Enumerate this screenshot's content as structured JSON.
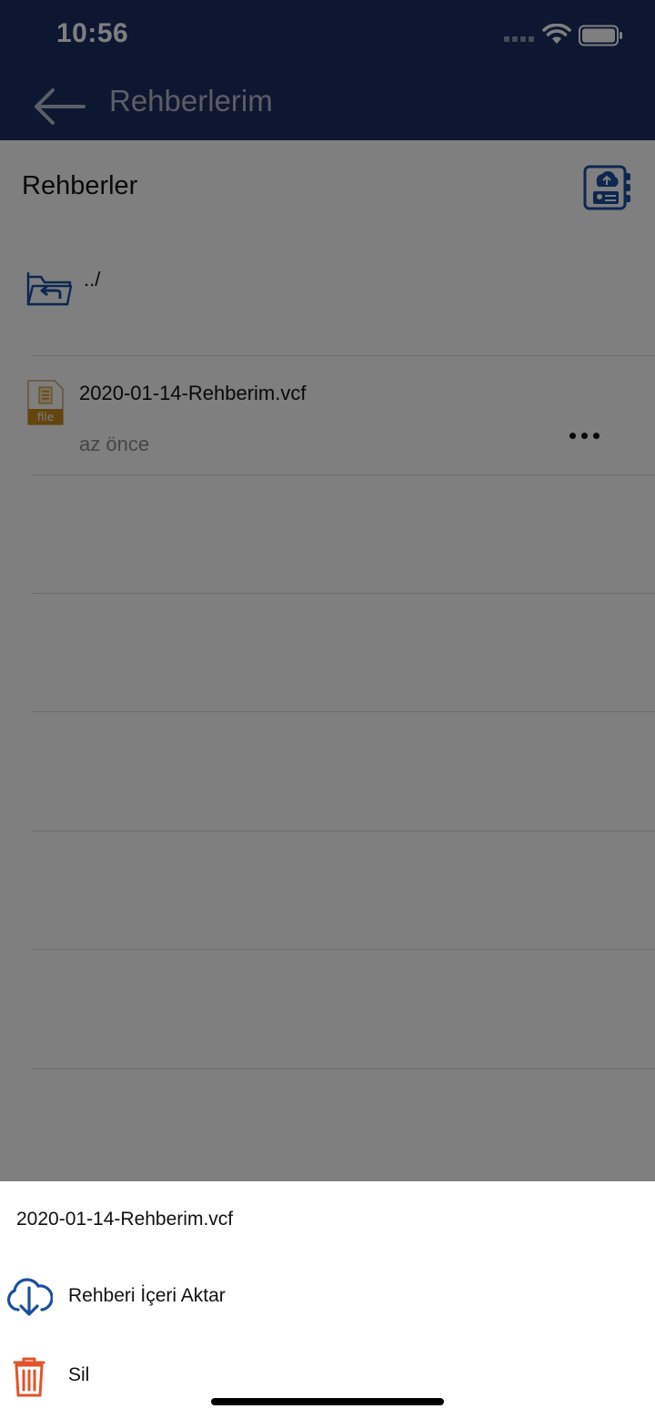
{
  "status_bar": {
    "time": "10:56"
  },
  "nav": {
    "title": "Rehberlerim"
  },
  "section": {
    "title": "Rehberler"
  },
  "parent_row": {
    "label": "../"
  },
  "file_row": {
    "name": "2020-01-14-Rehberim.vcf",
    "time": "az önce"
  },
  "action_sheet": {
    "title": "2020-01-14-Rehberim.vcf",
    "items": [
      {
        "label": "Rehberi İçeri Aktar",
        "icon": "cloud-download-icon"
      },
      {
        "label": "Sil",
        "icon": "trash-icon"
      }
    ]
  },
  "colors": {
    "header": "#1c2f62",
    "accent_blue": "#1b4f9e",
    "delete_red": "#e2542b",
    "file_orange": "#c98a1a"
  }
}
